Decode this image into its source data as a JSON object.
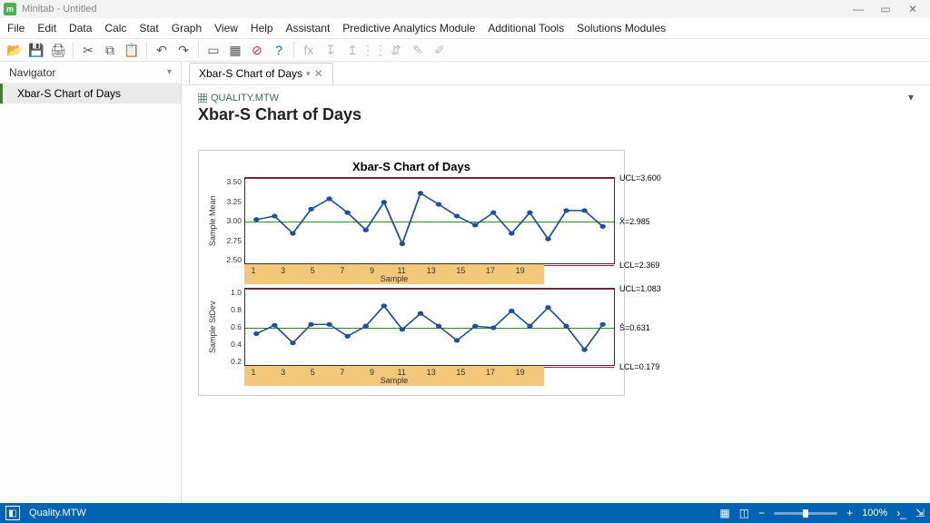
{
  "app": {
    "name": "m",
    "title": "Minitab - Untitled"
  },
  "window_controls": {
    "min": "—",
    "max": "▭",
    "close": "✕"
  },
  "menu": [
    "File",
    "Edit",
    "Data",
    "Calc",
    "Stat",
    "Graph",
    "View",
    "Help",
    "Assistant",
    "Predictive Analytics Module",
    "Additional Tools",
    "Solutions Modules"
  ],
  "toolbar_icons": [
    {
      "name": "open-icon",
      "glyph": "📂",
      "color": "#d9a437"
    },
    {
      "name": "save-icon",
      "glyph": "💾",
      "color": "#2a5ca8"
    },
    {
      "name": "print-icon",
      "glyph": "🖨",
      "color": "#555"
    },
    {
      "name": "cut-icon",
      "glyph": "✂",
      "color": "#555",
      "sep_before": true
    },
    {
      "name": "copy-icon",
      "glyph": "⧉",
      "color": "#555"
    },
    {
      "name": "paste-icon",
      "glyph": "📋",
      "color": "#555"
    },
    {
      "name": "undo-icon",
      "glyph": "↶",
      "color": "#555",
      "sep_before": true
    },
    {
      "name": "redo-icon",
      "glyph": "↷",
      "color": "#555"
    },
    {
      "name": "new-window-icon",
      "glyph": "▭",
      "color": "#555",
      "sep_before": true
    },
    {
      "name": "stats-icon",
      "glyph": "▦",
      "color": "#555"
    },
    {
      "name": "cancel-icon",
      "glyph": "⊘",
      "color": "#d23"
    },
    {
      "name": "help-icon",
      "glyph": "?",
      "color": "#16a"
    },
    {
      "name": "fx-icon",
      "glyph": "fx",
      "color": "#bbb",
      "sep_before": true
    },
    {
      "name": "ascending-icon",
      "glyph": "↧",
      "color": "#bbb"
    },
    {
      "name": "descending-icon",
      "glyph": "↥",
      "color": "#bbb"
    },
    {
      "name": "filter-icon",
      "glyph": "⋮⋮",
      "color": "#bbb"
    },
    {
      "name": "sort-icon",
      "glyph": "⇵",
      "color": "#bbb"
    },
    {
      "name": "highlight-icon",
      "glyph": "✎",
      "color": "#bbb"
    },
    {
      "name": "brush-icon",
      "glyph": "✐",
      "color": "#bbb"
    }
  ],
  "navigator": {
    "title": "Navigator",
    "items": [
      "Xbar-S Chart of Days"
    ]
  },
  "tab": {
    "label": "Xbar-S Chart of Days"
  },
  "document": {
    "file": "QUALITY.MTW",
    "title": "Xbar-S Chart of Days"
  },
  "chart_data": [
    {
      "type": "line",
      "title": "Xbar-S Chart of Days",
      "panel": "xbar",
      "ylabel": "Sample Mean",
      "xlabel": "Sample",
      "ylim": [
        2.369,
        3.6
      ],
      "yticks": [
        3.5,
        3.25,
        3.0,
        2.75,
        2.5
      ],
      "xticks": [
        1,
        3,
        5,
        7,
        9,
        11,
        13,
        15,
        17,
        19
      ],
      "x": [
        1,
        2,
        3,
        4,
        5,
        6,
        7,
        8,
        9,
        10,
        11,
        12,
        13,
        14,
        15,
        16,
        17,
        18,
        19,
        20
      ],
      "values": [
        3.0,
        3.05,
        2.8,
        3.15,
        3.3,
        3.1,
        2.85,
        3.25,
        2.65,
        3.38,
        3.22,
        3.05,
        2.92,
        3.1,
        2.8,
        3.1,
        2.72,
        3.13,
        3.13,
        2.9
      ],
      "limits": {
        "ucl": {
          "label": "UCL=3.600",
          "value": 3.6
        },
        "center": {
          "label": "X̄=2.985",
          "value": 2.985
        },
        "lcl": {
          "label": "LCL=2.369",
          "value": 2.369
        }
      }
    },
    {
      "type": "line",
      "panel": "s",
      "ylabel": "Sample StDev",
      "xlabel": "Sample",
      "ylim": [
        0.179,
        1.083
      ],
      "yticks": [
        1.0,
        0.8,
        0.6,
        0.4,
        0.2
      ],
      "xticks": [
        1,
        3,
        5,
        7,
        9,
        11,
        13,
        15,
        17,
        19
      ],
      "x": [
        1,
        2,
        3,
        4,
        5,
        6,
        7,
        8,
        9,
        10,
        11,
        12,
        13,
        14,
        15,
        16,
        17,
        18,
        19,
        20
      ],
      "values": [
        0.55,
        0.65,
        0.44,
        0.66,
        0.66,
        0.52,
        0.64,
        0.88,
        0.6,
        0.79,
        0.64,
        0.47,
        0.64,
        0.62,
        0.82,
        0.64,
        0.86,
        0.64,
        0.36,
        0.66
      ],
      "limits": {
        "ucl": {
          "label": "UCL=1.083",
          "value": 1.083
        },
        "center": {
          "label": "S̄=0.631",
          "value": 0.631
        },
        "lcl": {
          "label": "LCL=0.179",
          "value": 0.179
        }
      }
    }
  ],
  "taskbar": {
    "worksheet": "Quality.MTW",
    "zoom": "100%"
  }
}
